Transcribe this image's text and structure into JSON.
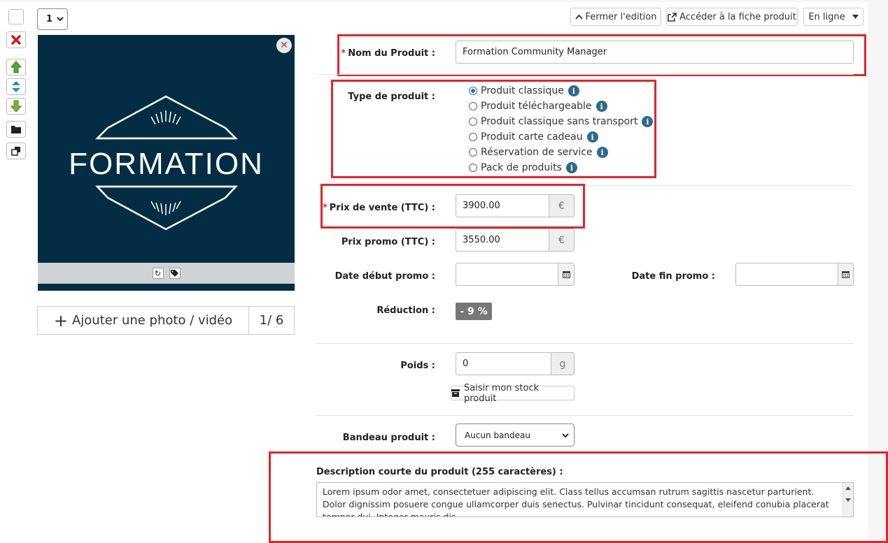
{
  "toolbar": {
    "position_select": "1"
  },
  "header": {
    "close_edit": "Fermer l'edition",
    "open_product": "Accéder à la fiche produit",
    "status": "En ligne"
  },
  "photo": {
    "logo_text": "FORMATION",
    "add_label": "Ajouter une photo / vidéo",
    "counter": "1/ 6"
  },
  "form": {
    "name_label": "Nom du Produit :",
    "name_value": "Formation Community Manager",
    "type_label": "Type de produit :",
    "types": [
      {
        "label": "Produit classique",
        "checked": true
      },
      {
        "label": "Produit téléchargeable",
        "checked": false
      },
      {
        "label": "Produit classique sans transport",
        "checked": false
      },
      {
        "label": "Produit carte cadeau",
        "checked": false
      },
      {
        "label": "Réservation de service",
        "checked": false
      },
      {
        "label": "Pack de produits",
        "checked": false
      }
    ],
    "price_label": "Prix de vente (TTC) :",
    "price_value": "3900.00",
    "currency": "€",
    "promo_label": "Prix promo (TTC) :",
    "promo_value": "3550.00",
    "promo_start_label": "Date début promo :",
    "promo_end_label": "Date fin promo :",
    "reduction_label": "Réduction :",
    "reduction_value": "- 9 %",
    "weight_label": "Poids :",
    "weight_value": "0",
    "weight_unit": "g",
    "stock_button": "Saisir mon stock produit",
    "banner_label": "Bandeau produit :",
    "banner_value": "Aucun bandeau",
    "desc_label": "Description courte du produit (255 caractères) :",
    "desc_value": "Lorem ipsum odor amet, consectetuer adipiscing elit. Class tellus accumsan rutrum sagittis nascetur parturient. Dolor dignissim posuere congue ullamcorper duis senectus. Pulvinar tincidunt consequat, eleifend conubia placerat tempor dui. Integer mauris dis."
  },
  "colors": {
    "highlight": "#e0262c",
    "photo_bg": "#032d44",
    "info": "#2b6a8e"
  }
}
